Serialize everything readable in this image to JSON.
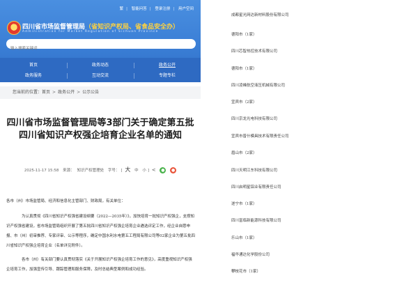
{
  "header": {
    "top_links": [
      "繁",
      "智能问答",
      "登录注册",
      "用户空间"
    ],
    "site_title_prefix": "四川省市场监督管理局",
    "site_title_highlight": "（省知识产权局、省食品安全办）",
    "site_title_en": "Administration for Market Regulation of Sichuan Province",
    "search_placeholder": "输入搜索关键词"
  },
  "nav": {
    "row1": [
      "首页",
      "政务动态",
      "政务公开"
    ],
    "row2": [
      "政务服务",
      "互动交流",
      "专题专栏"
    ],
    "active": "政务公开"
  },
  "breadcrumb": {
    "label": "您当前的位置：",
    "items": [
      "首页",
      "政务公开",
      "公示公告"
    ]
  },
  "article": {
    "title": "四川省市场监督管理局等3部门关于确定第五批四川省知识产权强企培育企业名单的通知",
    "date": "2025-11-17 15:58",
    "source_label": "来源：",
    "source": "知识产权管理处",
    "fontsize_label": "字号：",
    "font_large": "大",
    "font_medium": "中",
    "font_small": "小",
    "para1": "各市（州）市场监管局、经济和信息化主管部门、财政局，有关单位：",
    "para2": "为认真贯彻《四川省知识产权强省建设纲要（2022—2035年）》，加快培育一批知识产权强企，支撑知识产权强省建设，省市场监管局组织开展了第五批四川省知识产权强企培育企业遴选评定工作，经企业自愿申报、市（州）初审推荐、专家评审、公示等程序，确定中国水利水电第五工程局有限公司等02家企业为第五批四川省知识产权强企培育企业（名单详见附件）。",
    "para3": "各市（州）有关部门要认真贯彻落实《关于开展知识产权强企培育工作的意见》，高度重视知识产权强企培育工作，加强宣传引导、跟踪管理和服务保障，及时总结典型案例和成功经验。"
  },
  "right_list": [
    "成都星光网达新材料股份有限公司",
    "德阳市（1家）",
    "四川芯智热控技术有限公司",
    "德阳市（1家）",
    "四川凌峰航空液压机械有限公司",
    "宜宾市（2家）",
    "四川京龙光电科技有限公司",
    "宜宾市普什模具技术有限责任公司",
    "眉山市（2家）",
    "四川天明江东科技有限公司",
    "四川启明星铝业有限责任公司",
    "遂宁市（1家）",
    "四川富临新能源科技有限公司",
    "乐山市（1家）",
    "福华通达化学股份公司",
    "攀枝花市（1家）"
  ]
}
